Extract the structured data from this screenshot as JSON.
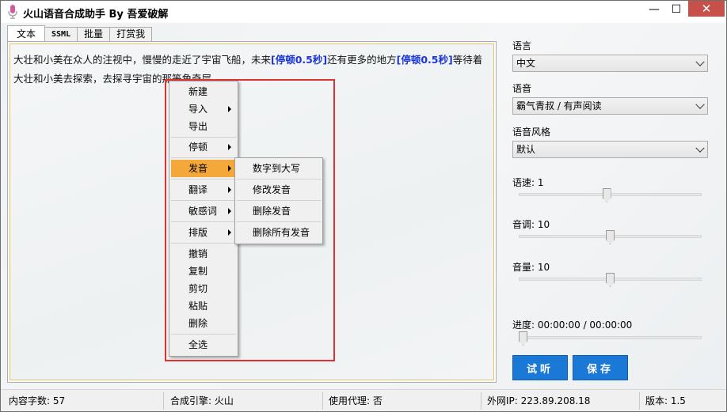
{
  "window": {
    "title": "火山语音合成助手 By 吾爱破解",
    "minimize_glyph": "—",
    "maximize_glyph": "☐",
    "close_glyph": "✕"
  },
  "tabs": [
    {
      "label": "文本",
      "active": true
    },
    {
      "label": "SSML",
      "active": false
    },
    {
      "label": "批量",
      "active": false
    },
    {
      "label": "打赏我",
      "active": false
    }
  ],
  "editor": {
    "line1_a": "大壮和小美在众人的注视中，慢慢的走近了宇宙飞船，未来",
    "pause1": "[停顿0.5秒]",
    "line1_b": "还有更多的地方",
    "pause2": "[停顿0.5秒]",
    "line1_c": "等待着",
    "line2": "大壮和小美去探索，去探寻宇宙的那等角奇层"
  },
  "context_menu": {
    "items": [
      {
        "label": "新建",
        "submenu": false
      },
      {
        "label": "导入",
        "submenu": true
      },
      {
        "label": "导出",
        "submenu": false
      },
      {
        "label": "停顿",
        "submenu": true
      },
      {
        "label": "发音",
        "submenu": true,
        "highlighted": true
      },
      {
        "label": "翻译",
        "submenu": true
      },
      {
        "label": "敏感词",
        "submenu": true
      },
      {
        "label": "排版",
        "submenu": true
      },
      {
        "label": "撤销",
        "submenu": false
      },
      {
        "label": "复制",
        "submenu": false
      },
      {
        "label": "剪切",
        "submenu": false
      },
      {
        "label": "粘贴",
        "submenu": false
      },
      {
        "label": "删除",
        "submenu": false
      },
      {
        "label": "全选",
        "submenu": false
      }
    ],
    "pronunciation_submenu": [
      {
        "label": "数字到大写"
      },
      {
        "label": "修改发音"
      },
      {
        "label": "删除发音"
      },
      {
        "label": "删除所有发音"
      }
    ],
    "highlight_color": "#f4a83a"
  },
  "settings": {
    "language_label": "语言",
    "language_value": "中文",
    "voice_label": "语音",
    "voice_value": "霸气青叔 / 有声阅读",
    "style_label": "语音风格",
    "style_value": "默认",
    "speed_label": "语速: 1",
    "speed_value": 0.48,
    "pitch_label": "音调: 10",
    "pitch_value": 0.5,
    "volume_label": "音量: 10",
    "volume_value": 0.5,
    "progress_label": "进度: 00:00:00 / 00:00:00",
    "progress_value": 0.0
  },
  "buttons": {
    "listen": "试听",
    "save": "保存",
    "accent": "#1a78d6"
  },
  "status": {
    "char_count": "内容字数: 57",
    "engine": "合成引擎: 火山",
    "proxy": "使用代理: 否",
    "ip": "外网IP: 223.89.208.18",
    "version": "版本: 1.5"
  }
}
